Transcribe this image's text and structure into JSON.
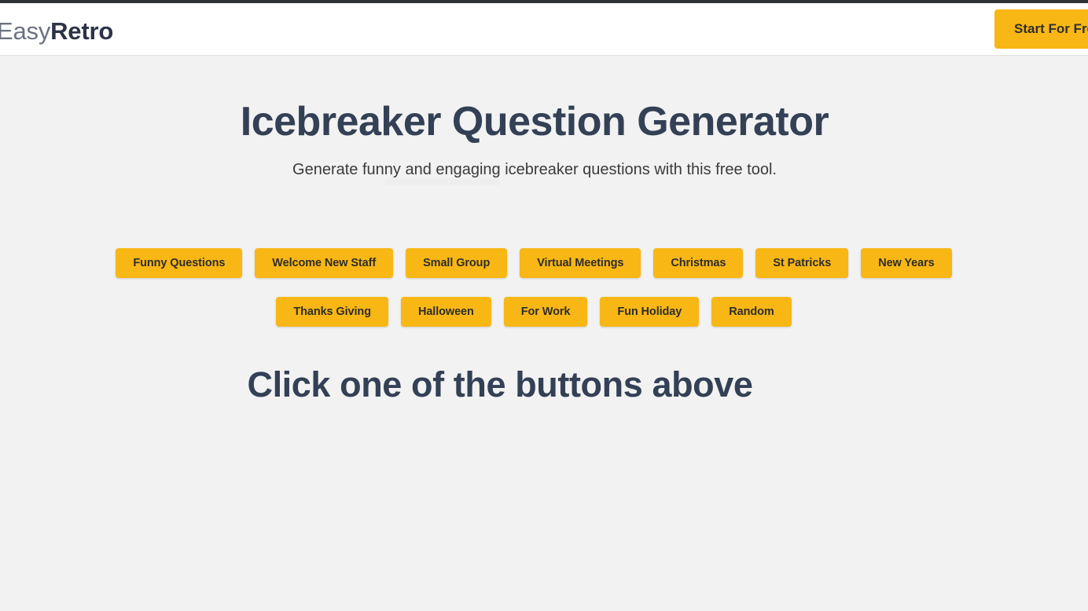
{
  "header": {
    "brand_primary": "Easy",
    "brand_secondary": "Retro",
    "cta_label": "Start For Free"
  },
  "hero": {
    "title": "Icebreaker Question Generator",
    "subtitle": "Generate funny and engaging icebreaker questions with this free tool."
  },
  "categories": {
    "row1": [
      {
        "label": "Funny Questions"
      },
      {
        "label": "Welcome New Staff"
      },
      {
        "label": "Small Group"
      },
      {
        "label": "Virtual Meetings"
      },
      {
        "label": "Christmas"
      },
      {
        "label": "St Patricks"
      },
      {
        "label": "New Years"
      }
    ],
    "row2": [
      {
        "label": "Thanks Giving"
      },
      {
        "label": "Halloween"
      },
      {
        "label": "For Work"
      },
      {
        "label": "Fun Holiday"
      },
      {
        "label": "Random"
      }
    ]
  },
  "result": {
    "placeholder_heading": "Click one of the buttons above"
  },
  "colors": {
    "accent_yellow": "#f9b715",
    "heading_navy": "#334055",
    "page_background": "#f2f2f2",
    "header_background": "#ffffff",
    "button_text": "#2d2d2d"
  }
}
